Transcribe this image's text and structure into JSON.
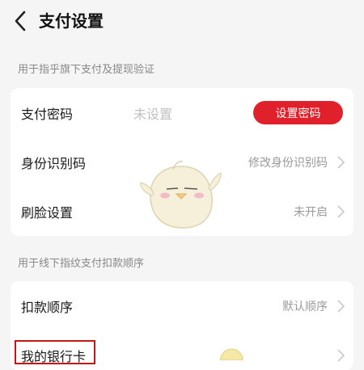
{
  "header": {
    "title": "支付设置"
  },
  "section1": {
    "label": "用于指乎旗下支付及提现验证"
  },
  "rows1": [
    {
      "label": "支付密码",
      "hint": "未设置",
      "button": "设置密码"
    },
    {
      "label": "身份识别码",
      "value": "修改身份识别码"
    },
    {
      "label": "刷脸设置",
      "value": "未开启"
    }
  ],
  "section2": {
    "label": "用于线下指纹支付扣款顺序"
  },
  "rows2": [
    {
      "label": "扣款顺序",
      "value": "默认顺序"
    },
    {
      "label": "我的银行卡"
    }
  ],
  "colors": {
    "accent": "#e0202a",
    "highlight_border": "#c41616"
  },
  "icons": {
    "back": "chevron-left-icon",
    "row_arrow": "chevron-right-icon",
    "mascot": "mascot-icon"
  }
}
